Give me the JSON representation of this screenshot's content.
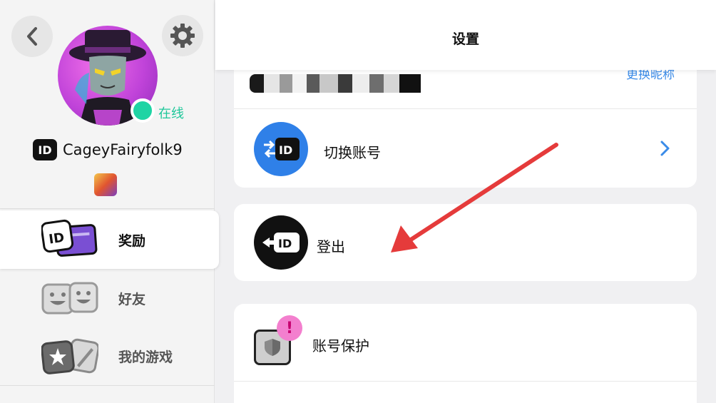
{
  "header": {
    "title": "设置"
  },
  "profile": {
    "status": "在线",
    "id_badge": "ID",
    "username": "CageyFairyfolk9"
  },
  "nav": [
    {
      "label": "奖励",
      "active": true,
      "icon": "id-card-icon"
    },
    {
      "label": "好友",
      "active": false,
      "icon": "friends-faces-icon"
    },
    {
      "label": "我的游戏",
      "active": false,
      "icon": "games-star-sword-icon"
    }
  ],
  "account": {
    "change_name": "更换昵称",
    "switch_account": "切换账号",
    "logout": "登出",
    "account_protection": "账号保护",
    "alert": "!"
  },
  "colors": {
    "accent_blue": "#2f80e8",
    "online_green": "#1fd4a4",
    "annotation_red": "#e53b3b",
    "alert_pink": "#f37fce"
  }
}
